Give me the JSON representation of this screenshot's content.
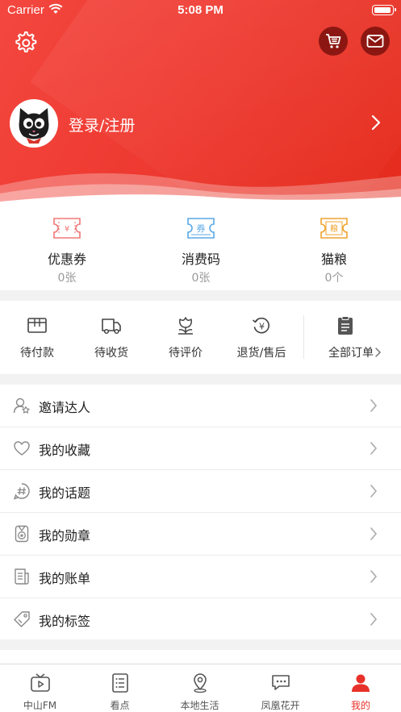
{
  "status_bar": {
    "carrier": "Carrier",
    "time": "5:08 PM"
  },
  "profile": {
    "login_label": "登录/注册"
  },
  "assets": [
    {
      "name": "优惠券",
      "count": "0张",
      "icon": "coupon-icon",
      "badge": "¥",
      "color": "#f07878"
    },
    {
      "name": "消费码",
      "count": "0张",
      "icon": "consumption-code-icon",
      "badge": "券",
      "color": "#5aa9e6"
    },
    {
      "name": "猫粮",
      "count": "0个",
      "icon": "cat-food-icon",
      "badge": "粮",
      "color": "#f0a431"
    }
  ],
  "orders": [
    {
      "label": "待付款",
      "icon": "pending-payment-icon"
    },
    {
      "label": "待收货",
      "icon": "delivery-truck-icon"
    },
    {
      "label": "待评价",
      "icon": "review-flower-icon"
    },
    {
      "label": "退货/售后",
      "icon": "refund-icon"
    },
    {
      "label": "全部订单",
      "icon": "all-orders-clipboard-icon"
    }
  ],
  "menu": [
    {
      "label": "邀请达人",
      "icon": "invite-user-icon"
    },
    {
      "label": "我的收藏",
      "icon": "heart-icon"
    },
    {
      "label": "我的话题",
      "icon": "hashtag-icon"
    },
    {
      "label": "我的勋章",
      "icon": "medal-icon"
    },
    {
      "label": "我的账单",
      "icon": "bill-icon"
    },
    {
      "label": "我的标签",
      "icon": "tag-icon"
    }
  ],
  "tabs": [
    {
      "label": "中山FM",
      "icon": "tv-icon",
      "active": false
    },
    {
      "label": "看点",
      "icon": "list-doc-icon",
      "active": false
    },
    {
      "label": "本地生活",
      "icon": "location-pin-icon",
      "active": false
    },
    {
      "label": "凤凰花开",
      "icon": "chat-bubble-icon",
      "active": false
    },
    {
      "label": "我的",
      "icon": "user-icon",
      "active": true
    }
  ],
  "colors": {
    "brand_red": "#e8312a",
    "header_top": "#f3473f",
    "button_dark": "#8c1712"
  }
}
